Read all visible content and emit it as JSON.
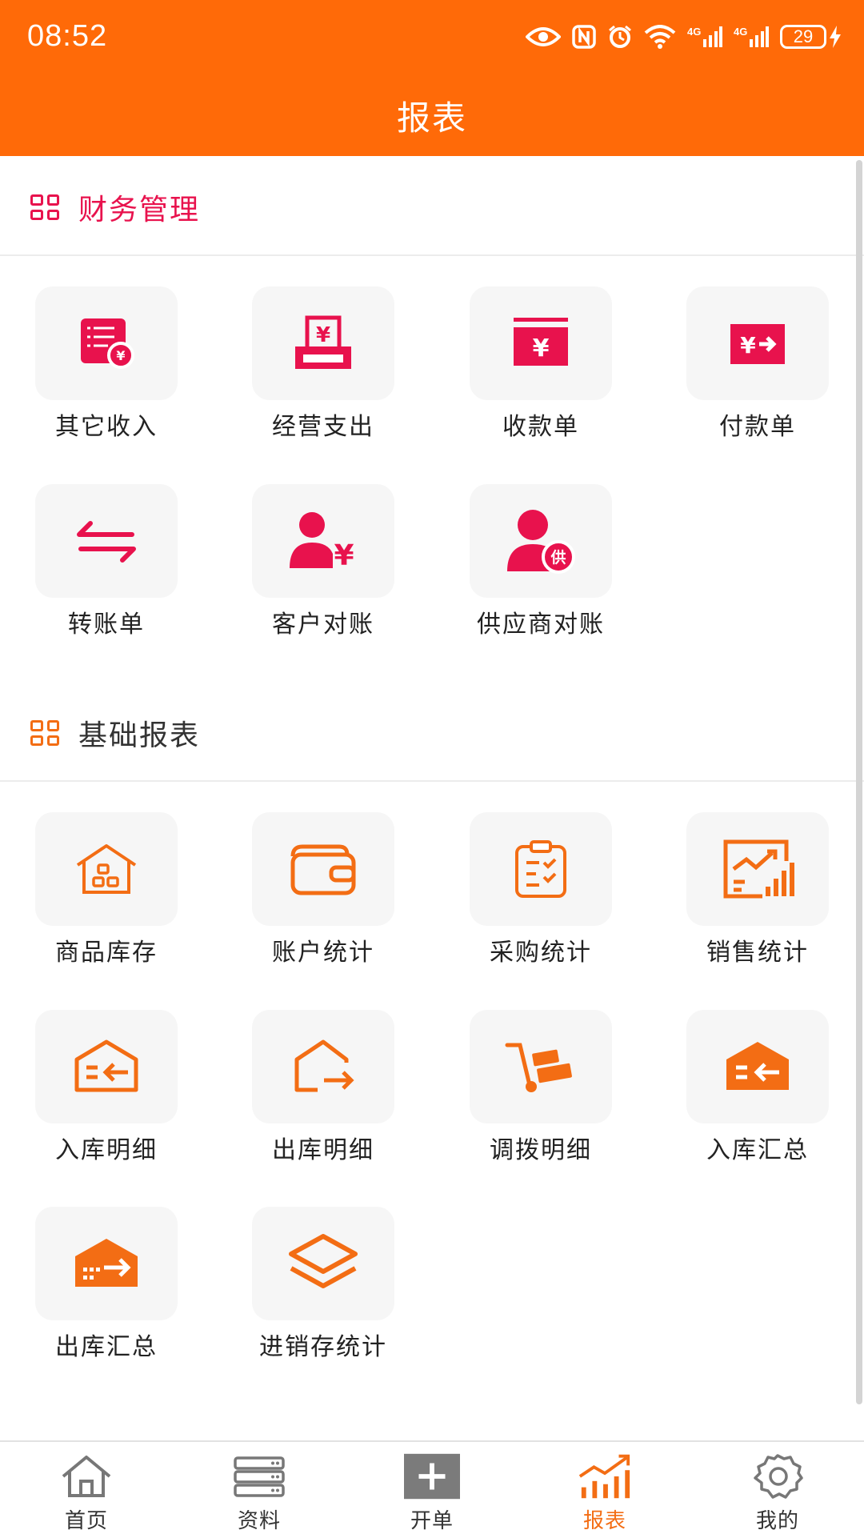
{
  "status_bar": {
    "time": "08:52",
    "battery": "29"
  },
  "nav": {
    "title": "报表"
  },
  "colors": {
    "header": "#ff6a08",
    "finance_accent": "#e8124d",
    "basic_accent": "#f36d14",
    "tab_active": "#f36d14"
  },
  "sections": [
    {
      "title": "财务管理",
      "items": [
        {
          "label": "其它收入",
          "icon": "income-list-icon"
        },
        {
          "label": "经营支出",
          "icon": "expense-printer-icon"
        },
        {
          "label": "收款单",
          "icon": "receipt-icon"
        },
        {
          "label": "付款单",
          "icon": "payment-icon"
        },
        {
          "label": "转账单",
          "icon": "transfer-arrows-icon"
        },
        {
          "label": "客户对账",
          "icon": "customer-yen-icon"
        },
        {
          "label": "供应商对账",
          "icon": "supplier-icon"
        }
      ]
    },
    {
      "title": "基础报表",
      "items": [
        {
          "label": "商品库存",
          "icon": "warehouse-icon"
        },
        {
          "label": "账户统计",
          "icon": "wallet-icon"
        },
        {
          "label": "采购统计",
          "icon": "clipboard-icon"
        },
        {
          "label": "销售统计",
          "icon": "sales-chart-icon"
        },
        {
          "label": "入库明细",
          "icon": "stock-in-icon"
        },
        {
          "label": "出库明细",
          "icon": "stock-out-icon"
        },
        {
          "label": "调拨明细",
          "icon": "cart-icon"
        },
        {
          "label": "入库汇总",
          "icon": "stock-in-summary-icon"
        },
        {
          "label": "出库汇总",
          "icon": "stock-out-summary-icon"
        },
        {
          "label": "进销存统计",
          "icon": "layers-icon"
        }
      ]
    }
  ],
  "supplier_badge": "供",
  "tabbar": [
    {
      "label": "首页",
      "icon": "home-icon"
    },
    {
      "label": "资料",
      "icon": "server-icon"
    },
    {
      "label": "开单",
      "icon": "plus-icon"
    },
    {
      "label": "报表",
      "icon": "chart-icon",
      "active": true
    },
    {
      "label": "我的",
      "icon": "gear-icon"
    }
  ]
}
